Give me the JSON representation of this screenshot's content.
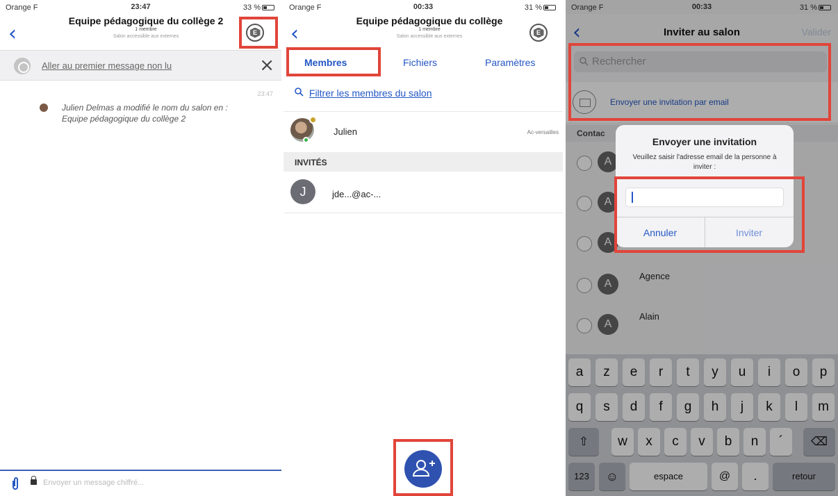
{
  "panel1": {
    "status": {
      "carrier": "Orange F",
      "time": "23:47",
      "battery": "33 %"
    },
    "back": "‹",
    "title": "Equipe pédagogique du collège 2",
    "subtitle": "1 membre",
    "subtitle2": "Salon accessible aux externes",
    "avatar_letter": "E",
    "banner": {
      "text": "Aller au premier message non lu",
      "close": "×"
    },
    "message": {
      "time": "23:47",
      "line1": "Julien Delmas a modifié le nom du salon en :",
      "line2": "Equipe pédagogique du collège 2"
    },
    "composer": {
      "placeholder": "Envoyer un message chiffré..."
    }
  },
  "panel2": {
    "status": {
      "carrier": "Orange F",
      "time": "00:33",
      "battery": "31 %"
    },
    "back": "‹",
    "title": "Equipe pédagogique du collège",
    "subtitle": "1 membre",
    "subtitle2": "Salon accessible aux externes",
    "avatar_letter": "E",
    "tabs": [
      "Membres",
      "Fichiers",
      "Paramètres"
    ],
    "filter": "Filtrer les membres du salon",
    "member": {
      "name": "Julien",
      "domain": "Ac-versailles"
    },
    "section": "INVITÉS",
    "guest": {
      "initial": "J",
      "name": "jde...@ac-..."
    }
  },
  "panel3": {
    "status": {
      "carrier": "Orange F",
      "time": "00:33",
      "battery": "31 %"
    },
    "back": "‹",
    "title": "Inviter au salon",
    "confirm": "Valider",
    "search_placeholder": "Rechercher",
    "invite_email": "Envoyer une invitation par email",
    "contacts_header": "Contac",
    "contacts": [
      {
        "initial": "A",
        "name": ""
      },
      {
        "initial": "A",
        "name": ""
      },
      {
        "initial": "A",
        "name": ""
      },
      {
        "initial": "A",
        "name": "Agence"
      },
      {
        "initial": "A",
        "name": "Alain"
      }
    ],
    "alert": {
      "title": "Envoyer une invitation",
      "message": "Veuillez saisir l'adresse email de la personne à inviter :",
      "cancel": "Annuler",
      "confirm": "Inviter"
    },
    "keyboard": {
      "row1": [
        "a",
        "z",
        "e",
        "r",
        "t",
        "y",
        "u",
        "i",
        "o",
        "p"
      ],
      "row2": [
        "q",
        "s",
        "d",
        "f",
        "g",
        "h",
        "j",
        "k",
        "l",
        "m"
      ],
      "row3": [
        "w",
        "x",
        "c",
        "v",
        "b",
        "n",
        "´"
      ],
      "shift": "⇧",
      "delete": "⌫",
      "numbers": "123",
      "emoji": "☺",
      "space": "espace",
      "at": "@",
      "dot": ".",
      "return": "retour"
    }
  },
  "colors": {
    "accent": "#2457c5",
    "highlight": "#e1453a",
    "fab": "#2f52b0"
  }
}
